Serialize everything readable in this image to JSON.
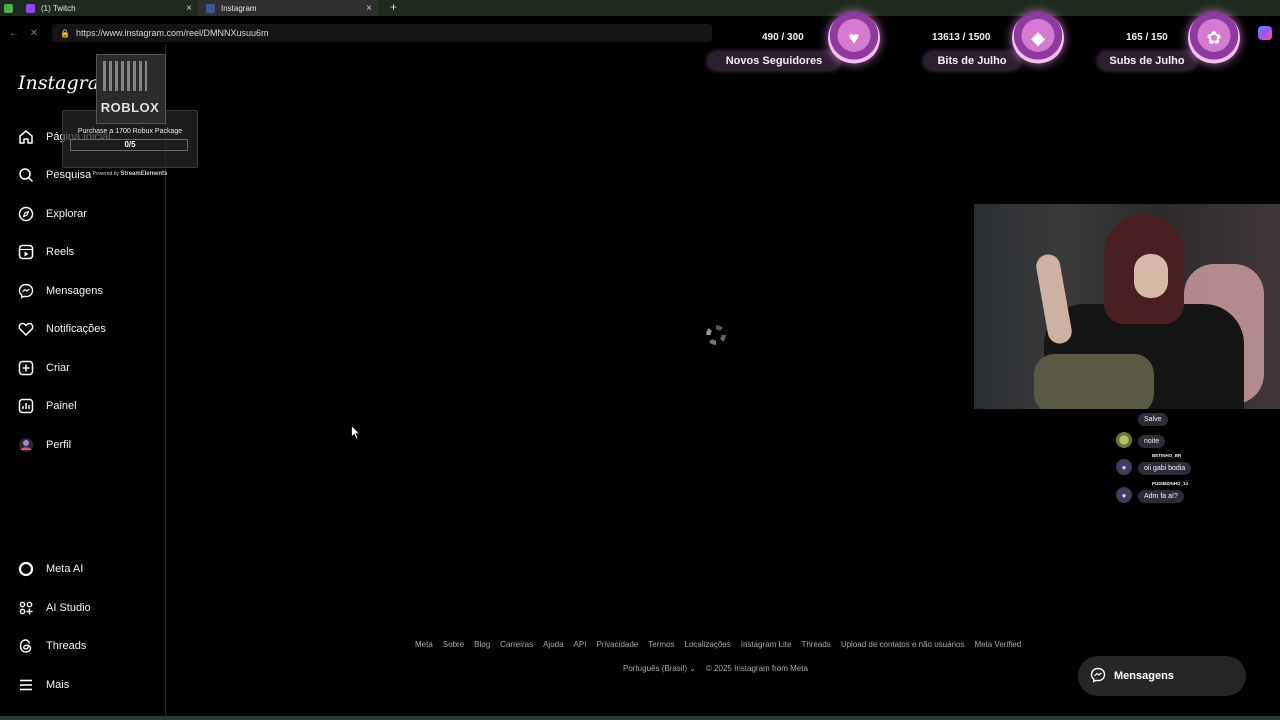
{
  "browser": {
    "tabs": [
      {
        "label": ""
      },
      {
        "label": "(1) Twitch"
      },
      {
        "label": "Instagram"
      }
    ],
    "url": "https://www.instagram.com/reel/DMNNXusuu6m"
  },
  "instagram": {
    "logo": "Instagram",
    "nav": [
      {
        "label": "Página inicial",
        "icon": "home-icon"
      },
      {
        "label": "Pesquisa",
        "icon": "search-icon"
      },
      {
        "label": "Explorar",
        "icon": "compass-icon"
      },
      {
        "label": "Reels",
        "icon": "reels-icon"
      },
      {
        "label": "Mensagens",
        "icon": "messenger-icon"
      },
      {
        "label": "Notificações",
        "icon": "heart-icon"
      },
      {
        "label": "Criar",
        "icon": "plus-square-icon"
      },
      {
        "label": "Painel",
        "icon": "dashboard-icon"
      },
      {
        "label": "Perfil",
        "icon": "avatar"
      }
    ],
    "nav_bottom": [
      {
        "label": "Meta AI",
        "icon": "meta-ai-icon"
      },
      {
        "label": "AI Studio",
        "icon": "ai-studio-icon"
      },
      {
        "label": "Threads",
        "icon": "threads-icon"
      },
      {
        "label": "Mais",
        "icon": "menu-icon"
      }
    ],
    "footer_links": [
      "Meta",
      "Sobre",
      "Blog",
      "Carreiras",
      "Ajuda",
      "API",
      "Privacidade",
      "Termos",
      "Localizações",
      "Instagram Lite",
      "Threads",
      "Upload de contatos e não usuários",
      "Meta Verified"
    ],
    "language": "Português (Brasil)",
    "copyright": "© 2025 Instagram from Meta",
    "messages_button": "Mensagens"
  },
  "overlay": {
    "roblox": {
      "brand": "ROBLOX",
      "purchase_text": "Purchase a 1700 Robux Package",
      "progress": "0/5",
      "powered_prefix": "Powered by",
      "powered_brand": "StreamElements"
    },
    "goals": [
      {
        "count": "490 / 300",
        "label": "Novos Seguidores",
        "icon": "heart-icon"
      },
      {
        "count": "13613 / 1500",
        "label": "Bits de Julho",
        "icon": "bits-gem-icon"
      },
      {
        "count": "165 / 150",
        "label": "Subs de Julho",
        "icon": "flower-icon"
      }
    ],
    "chat": [
      {
        "user": "",
        "text": "Salve"
      },
      {
        "user": "",
        "text": "noite"
      },
      {
        "user": "BETINHO_BR",
        "text": "oii gabi bodia"
      },
      {
        "user": "PUDIMZINHO_14",
        "text": "Adm fa aí?"
      }
    ]
  },
  "colors": {
    "background": "#000000",
    "goal_accent": "#d47ad0"
  }
}
